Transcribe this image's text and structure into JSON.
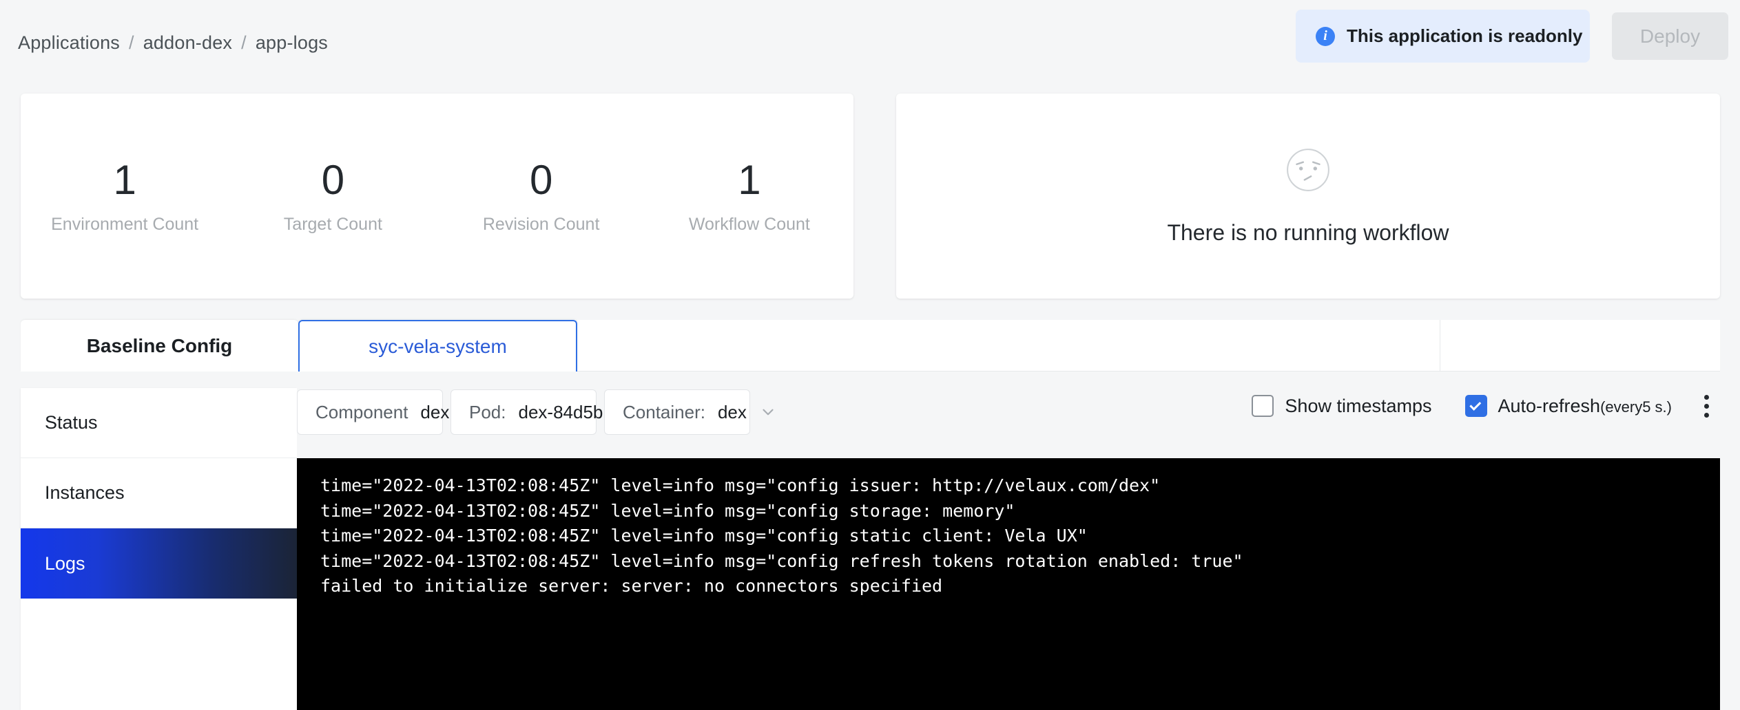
{
  "breadcrumb": {
    "items": [
      "Applications",
      "addon-dex",
      "app-logs"
    ],
    "separator": "/"
  },
  "header": {
    "readonly_notice": "This application is readonly",
    "info_icon": "info-circle-icon",
    "deploy_label": "Deploy",
    "deploy_disabled": true
  },
  "stats": [
    {
      "value": "1",
      "label": "Environment Count"
    },
    {
      "value": "0",
      "label": "Target Count"
    },
    {
      "value": "0",
      "label": "Revision Count"
    },
    {
      "value": "1",
      "label": "Workflow Count"
    }
  ],
  "workflow_panel": {
    "empty_icon": "confused-face-icon",
    "empty_text": "There is no running workflow"
  },
  "tabs": [
    {
      "label": "Baseline Config",
      "active": false
    },
    {
      "label": "syc-vela-system",
      "active": true
    }
  ],
  "sidebar": {
    "items": [
      {
        "label": "Status",
        "active": false
      },
      {
        "label": "Instances",
        "active": false
      },
      {
        "label": "Logs",
        "active": true
      }
    ]
  },
  "filters": {
    "component": {
      "label": "Component",
      "value": "dex",
      "icon": "chevron-down-icon"
    },
    "pod": {
      "label": "Pod:",
      "value": "dex-84d5b…",
      "icon": "chevron-down-icon"
    },
    "container": {
      "label": "Container:",
      "value": "dex",
      "icon": "chevron-down-icon"
    }
  },
  "toggles": {
    "show_timestamps": {
      "label": "Show timestamps",
      "checked": false
    },
    "auto_refresh": {
      "label_main": "Auto-refresh",
      "label_sub": "(every5 s.)",
      "checked": true
    },
    "more_menu_icon": "kebab-menu-icon"
  },
  "logs": {
    "lines": [
      "time=\"2022-04-13T02:08:45Z\" level=info msg=\"config issuer: http://velaux.com/dex\"",
      "time=\"2022-04-13T02:08:45Z\" level=info msg=\"config storage: memory\"",
      "time=\"2022-04-13T02:08:45Z\" level=info msg=\"config static client: Vela UX\"",
      "time=\"2022-04-13T02:08:45Z\" level=info msg=\"config refresh tokens rotation enabled: true\"",
      "failed to initialize server: server: no connectors specified"
    ]
  },
  "colors": {
    "accent_blue": "#2f6fe4",
    "active_nav_start": "#1438eb",
    "active_nav_end": "#1b2436",
    "banner_bg": "#e4edfd",
    "page_bg": "#f5f6f7",
    "log_bg": "#000000"
  }
}
